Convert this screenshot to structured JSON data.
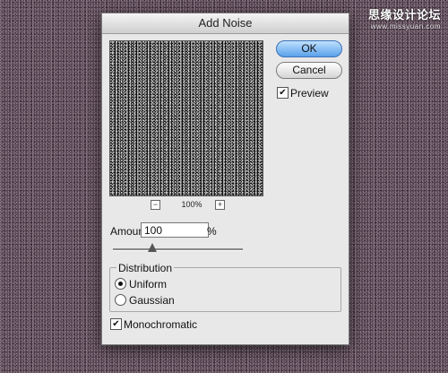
{
  "watermark": {
    "text": "思缘设计论坛",
    "sub": "www.missyuan.com"
  },
  "dialog": {
    "title": "Add Noise",
    "zoom": {
      "level": "100%",
      "minus": "−",
      "plus": "+"
    },
    "buttons": {
      "ok": "OK",
      "cancel": "Cancel"
    },
    "preview": {
      "label": "Preview",
      "checked": "✔"
    },
    "amount": {
      "label": "Amount:",
      "value": "100",
      "unit": "%",
      "slider_fraction": 0.3
    },
    "distribution": {
      "title": "Distribution",
      "options": [
        {
          "label": "Uniform",
          "selected": true
        },
        {
          "label": "Gaussian",
          "selected": false
        }
      ]
    },
    "monochromatic": {
      "label": "Monochromatic",
      "checked": "✔"
    }
  }
}
